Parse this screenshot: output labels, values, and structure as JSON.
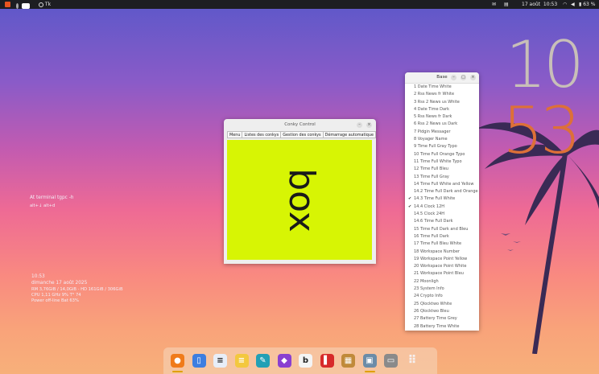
{
  "topbar": {
    "app_label": "Tk",
    "date": "17 août",
    "time": "10:53",
    "battery": "63 %",
    "icons": [
      "ubuntu-logo-icon",
      "tk-app-icon",
      "mail-icon",
      "notes-icon",
      "wifi-icon",
      "volume-icon",
      "battery-icon"
    ]
  },
  "big_clock": {
    "hours": "10",
    "minutes": "53",
    "hours_color": "#c8bfb8",
    "minutes_color": "#dd7038"
  },
  "desktop_conky": {
    "shortcut_line1": "At  terminal  tgpc -h",
    "shortcut_line2": "alt+↓   alt+d",
    "time": "10:53",
    "date": "dimanche 17 août 2025",
    "ram_line": "RM 3,76GiB / 14,0GiB - HD 161GiB / 306GiB",
    "cpu_line": "CPU 1,11 GHz  9%   T° 74",
    "power_line": "Power off-line Bat 63%"
  },
  "conky_control": {
    "title": "Conky Control",
    "menu": [
      "Menu",
      "Listes des conkys",
      "Gestion des conkys",
      "Démarrage automatique"
    ],
    "preview_text": "box",
    "preview_bg": "#d7f504"
  },
  "base": {
    "title": "Base",
    "items": [
      {
        "label": "1 Date Time White",
        "checked": false
      },
      {
        "label": "2 Rss News fr White",
        "checked": false
      },
      {
        "label": "3 Rss 2 News us White",
        "checked": false
      },
      {
        "label": "4 Date Time Dark",
        "checked": false
      },
      {
        "label": "5 Rss News fr Dark",
        "checked": false
      },
      {
        "label": "6 Rss 2 News us Dark",
        "checked": false
      },
      {
        "label": "7 Pidgin Messager",
        "checked": false
      },
      {
        "label": "8 Voyager Name",
        "checked": false
      },
      {
        "label": "9 Time Full Gray Typo",
        "checked": false
      },
      {
        "label": "10 Time Full Orange Typo",
        "checked": false
      },
      {
        "label": "11 Time Full White Typo",
        "checked": false
      },
      {
        "label": "12 Time Full Bleu",
        "checked": false
      },
      {
        "label": "13 Time Full Gray",
        "checked": false
      },
      {
        "label": "14 Time Full White and Yellow",
        "checked": false
      },
      {
        "label": "14.2 Time Full Dark and Orange",
        "checked": false
      },
      {
        "label": "14.3 Time Full White",
        "checked": true
      },
      {
        "label": "14.4 Clock 12H",
        "checked": true
      },
      {
        "label": "14.5 Clock 24H",
        "checked": false
      },
      {
        "label": "14.6 Time Full Dark",
        "checked": false
      },
      {
        "label": "15 Time Full Dark and Bleu",
        "checked": false
      },
      {
        "label": "16 Time Full Dark",
        "checked": false
      },
      {
        "label": "17 Time Full Bleu White",
        "checked": false
      },
      {
        "label": "18 Workspace Number",
        "checked": false
      },
      {
        "label": "19 Workspace Point Yellow",
        "checked": false
      },
      {
        "label": "20 Workspace Point White",
        "checked": false
      },
      {
        "label": "21 Workspace Point Bleu",
        "checked": false
      },
      {
        "label": "22 Moonligh",
        "checked": false
      },
      {
        "label": "23 System Info",
        "checked": false
      },
      {
        "label": "24 Crypto Info",
        "checked": false
      },
      {
        "label": "25 Qlocktwo White",
        "checked": false
      },
      {
        "label": "26 Qlocktwo Bleu",
        "checked": false
      },
      {
        "label": "27 Battery Time Grey",
        "checked": false
      },
      {
        "label": "28 Battery Time White",
        "checked": false
      }
    ]
  },
  "window_buttons": {
    "minimize": "–",
    "maximize": "□",
    "close": "×"
  },
  "dock": {
    "icons": [
      {
        "name": "firefox-icon",
        "bg": "#f07b1a",
        "glyph": "●",
        "active": true
      },
      {
        "name": "files-icon",
        "bg": "#3d7ee0",
        "glyph": "▯",
        "active": false
      },
      {
        "name": "writer-icon",
        "bg": "#e8eef8",
        "glyph": "≡",
        "active": false
      },
      {
        "name": "notes-icon",
        "bg": "#f3c83e",
        "glyph": "≡",
        "active": false
      },
      {
        "name": "inkscape-icon",
        "bg": "#22a0b5",
        "glyph": "✎",
        "active": false
      },
      {
        "name": "photos-icon",
        "bg": "#8a3fd0",
        "glyph": "◆",
        "active": false
      },
      {
        "name": "conky-box-icon",
        "bg": "#f4f4f4",
        "glyph": "b",
        "active": false
      },
      {
        "name": "reader-icon",
        "bg": "#d72a2a",
        "glyph": "▌",
        "active": false
      },
      {
        "name": "tuner-icon",
        "bg": "#c08a3a",
        "glyph": "▦",
        "active": false
      },
      {
        "name": "tk-app-icon",
        "bg": "#6b8ca8",
        "glyph": "▣",
        "active": true
      },
      {
        "name": "trash-icon",
        "bg": "#8a8a8a",
        "glyph": "▭",
        "active": false
      },
      {
        "name": "app-grid-icon",
        "bg": "transparent",
        "glyph": "⠿",
        "active": false
      }
    ]
  }
}
